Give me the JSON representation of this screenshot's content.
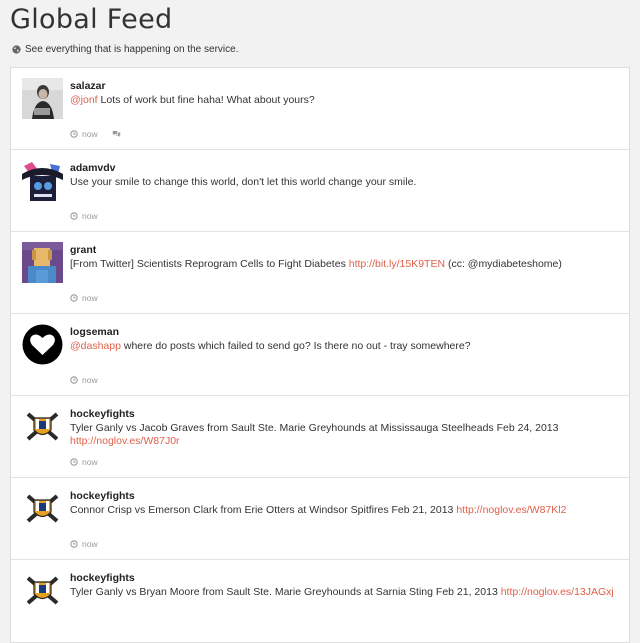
{
  "page": {
    "title": "Global Feed",
    "subtitle": "See everything that is happening on the service."
  },
  "posts": [
    {
      "user": "salazar",
      "mention": "@jonf",
      "text": " Lots of work but fine haha! What about yours?",
      "time": "now",
      "has_reply_icon": true
    },
    {
      "user": "adamvdv",
      "text": "Use your smile to change this world, don't let this world change your smile.",
      "time": "now"
    },
    {
      "user": "grant",
      "text": "[From Twitter] Scientists Reprogram Cells to Fight Diabetes ",
      "link": "http://bit.ly/15K9TEN",
      "text_after": " (cc: @mydiabeteshome)",
      "time": "now"
    },
    {
      "user": "logseman",
      "mention": "@dashapp",
      "text": " where do posts which failed to send go? Is there no out - tray somewhere?",
      "time": "now"
    },
    {
      "user": "hockeyfights",
      "text": "Tyler Ganly vs Jacob Graves from Sault Ste. Marie Greyhounds at Mississauga Steelheads Feb 24, 2013 ",
      "link": "http://noglov.es/W87J0r",
      "time": "now"
    },
    {
      "user": "hockeyfights",
      "text": "Connor Crisp vs Emerson Clark from Erie Otters at Windsor Spitfires Feb 21, 2013 ",
      "link": "http://noglov.es/W87Kl2",
      "time": "now"
    },
    {
      "user": "hockeyfights",
      "text": "Tyler Ganly vs Bryan Moore from Sault Ste. Marie Greyhounds at Sarnia Sting Feb 21, 2013 ",
      "link": "http://noglov.es/13JAGxj",
      "time": "now"
    }
  ],
  "icons": {
    "globe": "globe-icon",
    "clock": "clock-icon",
    "comment": "comment-icon"
  },
  "colors": {
    "link": "#e0604a",
    "background": "#f2f2f2"
  }
}
